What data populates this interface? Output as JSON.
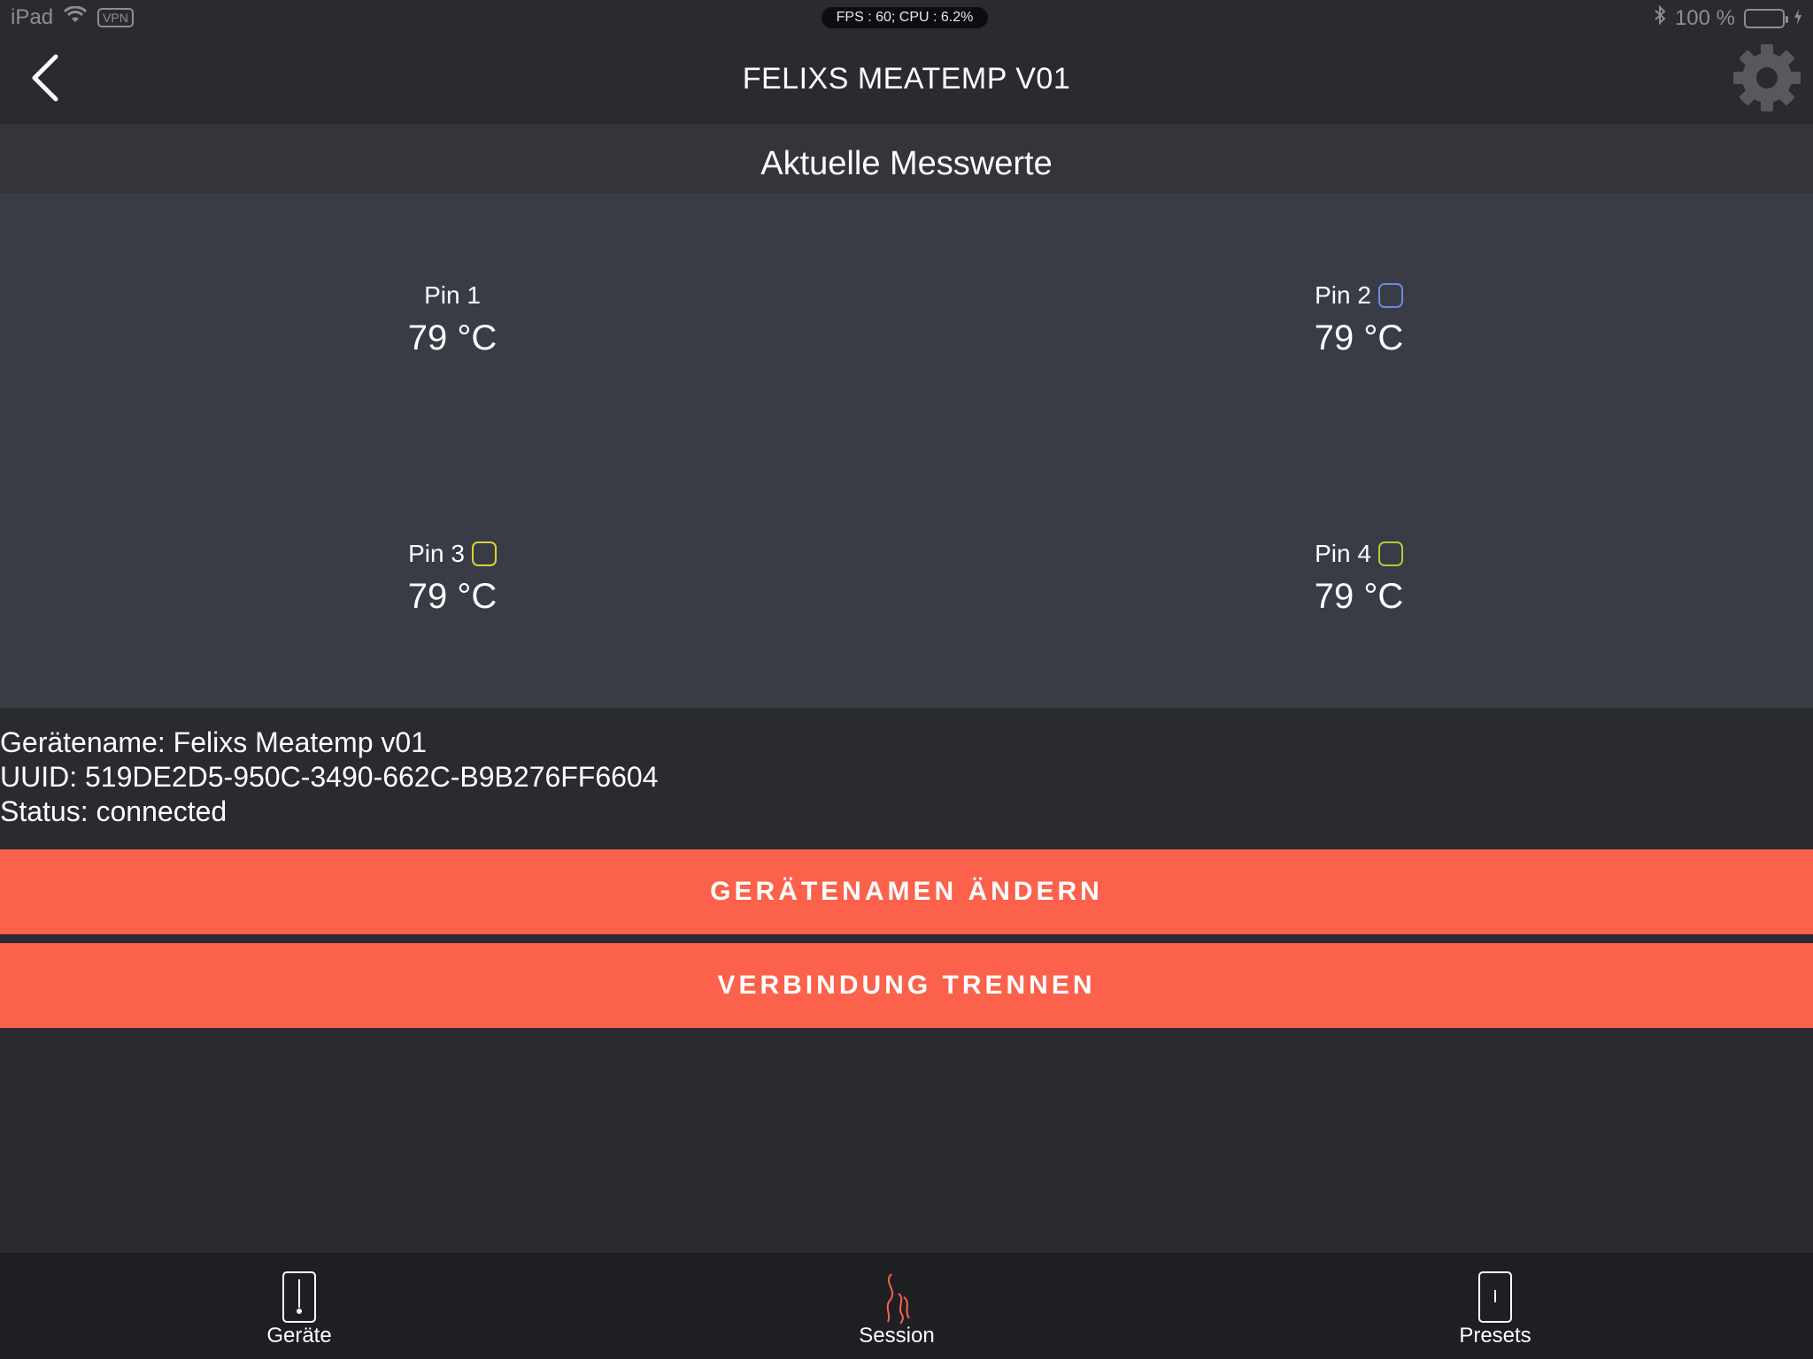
{
  "status_bar": {
    "device": "iPad",
    "vpn": "VPN",
    "fps": "FPS : 60; CPU : 6.2%",
    "battery_percent": "100 %",
    "battery_level": 1.0,
    "battery_color": "#4cd964"
  },
  "nav": {
    "title": "FELIXS MEATEMP V01",
    "back_icon": "chevron-left-icon",
    "settings_icon": "gear-icon"
  },
  "section": {
    "title": "Aktuelle Messwerte"
  },
  "pins": [
    {
      "label": "Pin 1",
      "value": "79 °C",
      "swatch_color": null
    },
    {
      "label": "Pin 2",
      "value": "79 °C",
      "swatch_color": "#6f86e8"
    },
    {
      "label": "Pin 3",
      "value": "79 °C",
      "swatch_color": "#d8d23a"
    },
    {
      "label": "Pin 4",
      "value": "79 °C",
      "swatch_color": "#a9d03a"
    }
  ],
  "info": {
    "device_name": "Gerätename: Felixs Meatemp v01",
    "uuid": "UUID: 519DE2D5-950C-3490-662C-B9B276FF6604",
    "status": "Status: connected"
  },
  "buttons": {
    "rename": "GERÄTENAMEN ÄNDERN",
    "disconnect": "VERBINDUNG TRENNEN",
    "accent_color": "#fb614b"
  },
  "tabs": [
    {
      "label": "Geräte",
      "icon": "thermometer-icon"
    },
    {
      "label": "Session",
      "icon": "smoke-icon"
    },
    {
      "label": "Presets",
      "icon": "preset-card-icon"
    }
  ]
}
